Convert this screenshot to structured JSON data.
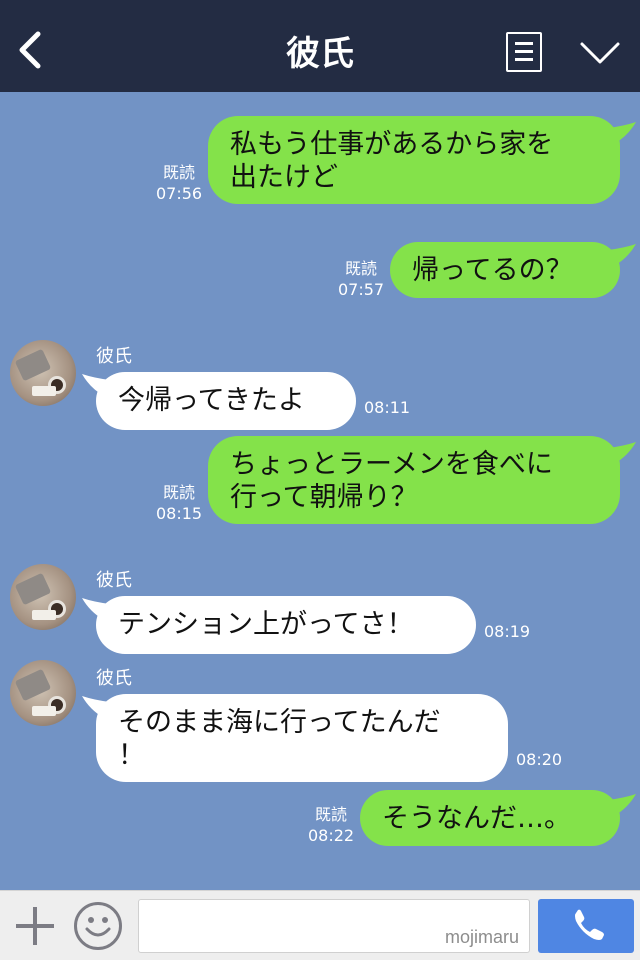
{
  "header": {
    "title": "彼氏",
    "back_icon": "chevron-left-icon",
    "menu_icon": "menu-list-icon",
    "collapse_icon": "chevron-down-icon",
    "background": "#232c43"
  },
  "colors": {
    "chat_background": "#7293c5",
    "my_bubble": "#84e24a",
    "their_bubble": "#ffffff",
    "call_button": "#4f86e3"
  },
  "messages": [
    {
      "from": "me",
      "text": "私もう仕事があるから家を\n出たけど",
      "read": "既読",
      "time": "07:56"
    },
    {
      "from": "me",
      "text": "帰ってるの？",
      "read": "既読",
      "time": "07:57"
    },
    {
      "from": "them",
      "sender": "彼氏",
      "text": "今帰ってきたよ",
      "time": "08:11"
    },
    {
      "from": "me",
      "text": "ちょっとラーメンを食べに\n行って朝帰り？",
      "read": "既読",
      "time": "08:15"
    },
    {
      "from": "them",
      "sender": "彼氏",
      "text": "テンション上がってさ！",
      "time": "08:19"
    },
    {
      "from": "them",
      "sender": "彼氏",
      "text": "そのまま海に行ってたんだ\n！",
      "time": "08:20"
    },
    {
      "from": "me",
      "text": "そうなんだ…。",
      "read": "既読",
      "time": "08:22"
    }
  ],
  "input_bar": {
    "plus_icon": "plus-icon",
    "emoji_icon": "smiley-icon",
    "placeholder": "",
    "watermark": "mojimaru",
    "call_icon": "phone-icon"
  }
}
